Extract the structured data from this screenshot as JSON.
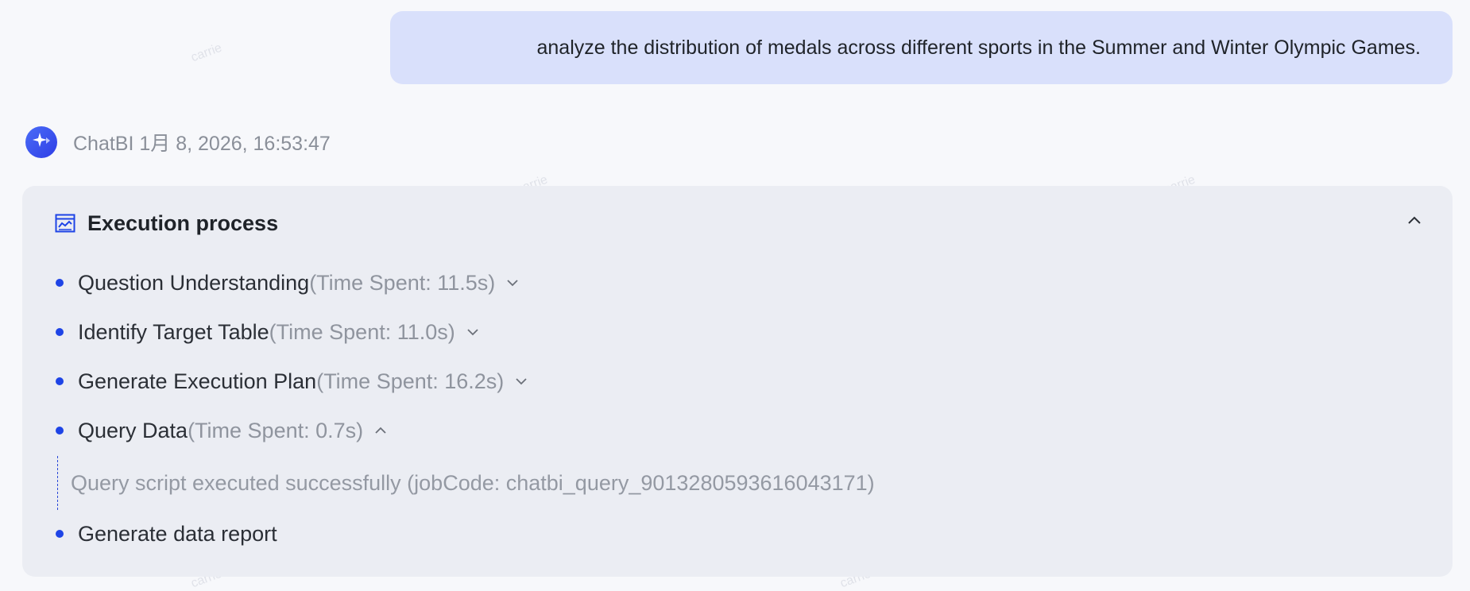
{
  "user_message": {
    "text": "analyze the distribution of medals across different sports in the Summer and Winter Olympic Games."
  },
  "bot": {
    "name_and_time": "ChatBI 1月 8, 2026, 16:53:47",
    "avatar_icon": "sparkle-icon"
  },
  "execution": {
    "title": "Execution process",
    "icon": "chart-frame-icon",
    "collapse_icon": "chevron-up-icon",
    "steps": [
      {
        "label": "Question Understanding",
        "time": "(Time Spent: 11.5s)",
        "chevron": "chevron-down-icon"
      },
      {
        "label": "Identify Target Table",
        "time": "(Time Spent: 11.0s)",
        "chevron": "chevron-down-icon"
      },
      {
        "label": "Generate Execution Plan",
        "time": "(Time Spent: 16.2s)",
        "chevron": "chevron-down-icon"
      },
      {
        "label": "Query Data",
        "time": "(Time Spent: 0.7s)",
        "chevron": "chevron-up-icon",
        "detail": "Query script executed successfully (jobCode: chatbi_query_901328059361604317​1)"
      },
      {
        "label": "Generate data report",
        "time": ""
      }
    ]
  },
  "colors": {
    "accent": "#1e44e6",
    "user_bubble": "#d9e0fb",
    "panel_bg": "#ebedf3",
    "muted_text": "#8f949e"
  },
  "watermark": "carrie"
}
